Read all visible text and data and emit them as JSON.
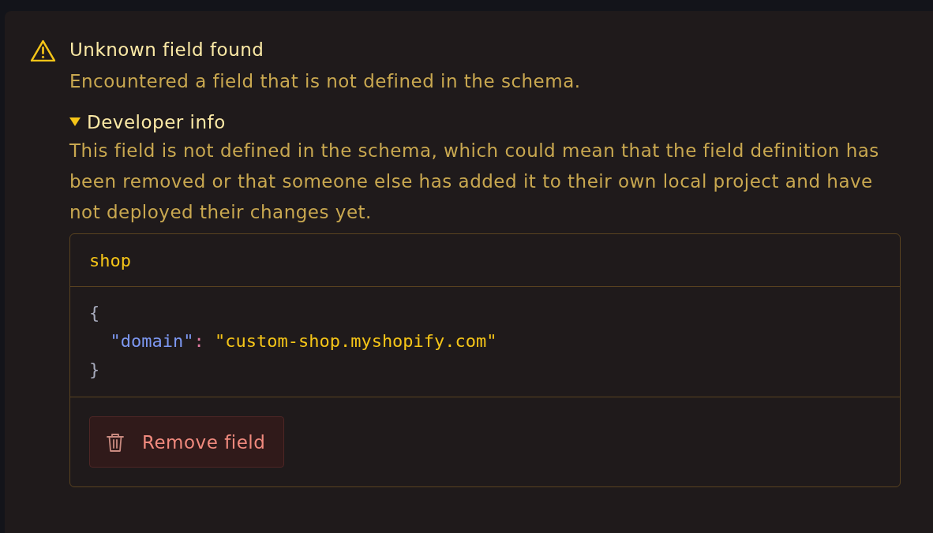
{
  "alert": {
    "title": "Unknown field found",
    "description": "Encountered a field that is not defined in the schema.",
    "details": {
      "summary": "Developer info",
      "expanded": true,
      "text": "This field is not defined in the schema, which could mean that the field definition has been removed or that someone else has added it to their own local project and have not deployed their changes yet."
    },
    "field": {
      "name": "shop",
      "code_lines": [
        {
          "indented": false,
          "tokens": [
            {
              "kind": "punct",
              "text": "{"
            }
          ]
        },
        {
          "indented": true,
          "tokens": [
            {
              "kind": "key",
              "text": "\"domain\""
            },
            {
              "kind": "colon",
              "text": ": "
            },
            {
              "kind": "string",
              "text": "\"custom-shop.myshopify.com\""
            }
          ]
        },
        {
          "indented": false,
          "tokens": [
            {
              "kind": "punct",
              "text": "}"
            }
          ]
        }
      ]
    },
    "button": {
      "label": "Remove field"
    }
  }
}
